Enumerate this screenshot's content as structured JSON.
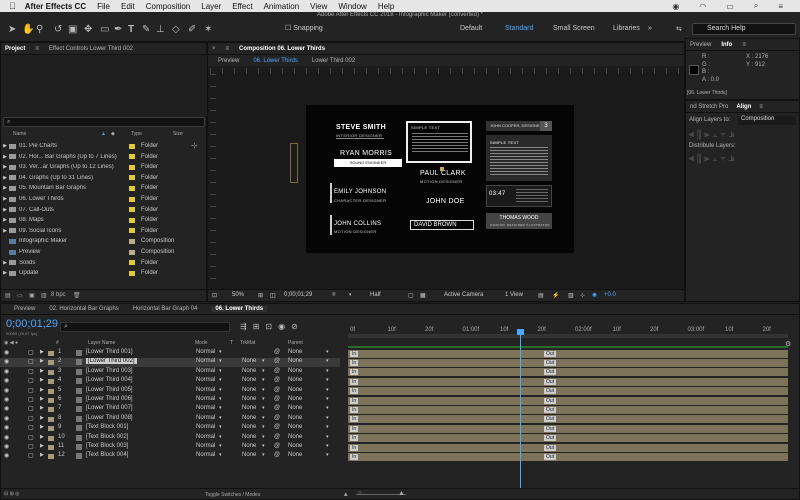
{
  "menubar": {
    "app": "After Effects CC",
    "items": [
      "File",
      "Edit",
      "Composition",
      "Layer",
      "Effect",
      "Animation",
      "View",
      "Window",
      "Help"
    ]
  },
  "toolbar": {
    "doc_title": "Adobe After Effects CC 2018 - Infographic Maker (converted) *",
    "snapping": "Snapping",
    "workspaces": [
      "Default",
      "Standard",
      "Small Screen",
      "Libraries"
    ],
    "search_placeholder": "Search Help"
  },
  "project": {
    "tabs": [
      "Project",
      "Effect Controls Lower Third 002"
    ],
    "search_placeholder": "",
    "columns": {
      "name": "Name",
      "type": "Type",
      "size": "Size"
    },
    "items": [
      {
        "name": "01. Pie Charts",
        "type": "Folder",
        "color": "#e0c93a"
      },
      {
        "name": "02. Hor... Bar Graphs (Up to 7 Lines)",
        "type": "Folder",
        "color": "#e0c93a"
      },
      {
        "name": "03. Ver...ar Graphs (Up to 12 Lines)",
        "type": "Folder",
        "color": "#e0c93a"
      },
      {
        "name": "04. Graphs (Up to 31 Lines)",
        "type": "Folder",
        "color": "#e0c93a"
      },
      {
        "name": "05. Mountain Bar Graphs",
        "type": "Folder",
        "color": "#e0c93a"
      },
      {
        "name": "06. Lower Thirds",
        "type": "Folder",
        "color": "#e0c93a"
      },
      {
        "name": "07. Call-Outs",
        "type": "Folder",
        "color": "#e0c93a"
      },
      {
        "name": "08. Maps",
        "type": "Folder",
        "color": "#e0c93a"
      },
      {
        "name": "09. Social Icons",
        "type": "Folder",
        "color": "#e0c93a"
      },
      {
        "name": "Infographic Maker",
        "type": "Composition",
        "color": "#b8b08c"
      },
      {
        "name": "Preview",
        "type": "Composition",
        "color": "#b8b08c"
      },
      {
        "name": "Solids",
        "type": "Folder",
        "color": "#e0c93a"
      },
      {
        "name": "Update",
        "type": "Folder",
        "color": "#e0c93a"
      }
    ],
    "bpc": "8 bpc"
  },
  "composition": {
    "tab_label": "Composition 06. Lower Thirds",
    "breadcrumbs": [
      "Preview",
      "06. Lower Thirds",
      "Lower Third 002"
    ],
    "zoom": "50%",
    "timecode": "0;00;01;29",
    "resolution": "Half",
    "camera": "Active Camera",
    "views": "1 View",
    "exposure": "+0.0"
  },
  "canvas": {
    "name1": "STEVE SMITH",
    "role1": "INTERIOR DESIGNER",
    "name2": "RYAN MORRIS",
    "role2": "SOUND ENGINEER",
    "name3": "EMILY JOHNSON",
    "role3": "CHARACTER DESIGNER",
    "name4": "JOHN COLLINS",
    "role4": "MOTION DESIGNER",
    "simple_text": "SIMPLE TEXT",
    "name5": "PAUL CLARK",
    "role5": "MOTION DESIGNER",
    "name6": "JOHN DOE",
    "name7": "DAVID BROWN",
    "ribbon1": "JOHN COOPER, DESIGNER",
    "ribbon1_num": "3",
    "box_title": "SIMPLE TEXT",
    "clock": "03:47",
    "name8": "THOMAS WOOD",
    "role8": "GRAPHIC DESIGNER ILLUSTRATOR"
  },
  "right": {
    "preview_tab": "Preview",
    "info_tab": "Info",
    "r": "R :",
    "g": "G :",
    "b": "B :",
    "a": "A : 0.0",
    "x": "X : 2176",
    "y": "Y : 912",
    "lt": "[06. Lower Thirds]",
    "align_tabs": [
      "nd Stretch Pro",
      "Align"
    ],
    "align_to_label": "Align Layers to:",
    "align_to_value": "Composition",
    "distribute_label": "Distribute Layers:"
  },
  "timeline": {
    "tabs": [
      "Preview",
      "02. Horizontal Bar Graphs",
      "Horizontal Bar Graph 04",
      "06. Lower Thirds"
    ],
    "timecode": "0;00;01;29",
    "timecode_sub": "00059 (29.97 fps)",
    "columns": {
      "layer_name": "Layer Name",
      "mode": "Mode",
      "t": "T",
      "trkmat": "TrkMat",
      "parent": "Parent"
    },
    "ruler": [
      "0f",
      "10f",
      "20f",
      "01:00f",
      "10f",
      "20f",
      "02:00f",
      "10f",
      "20f",
      "03:00f",
      "10f",
      "20f"
    ],
    "layers": [
      {
        "num": "1",
        "name": "[Lower Third 001]",
        "mode": "Normal",
        "trkmat": "",
        "parent": "None",
        "in": "In",
        "out": "Out"
      },
      {
        "num": "2",
        "name": "[Lower Third 002]",
        "mode": "Normal",
        "trkmat": "None",
        "parent": "None",
        "in": "In",
        "out": "Out"
      },
      {
        "num": "3",
        "name": "[Lower Third 003]",
        "mode": "Normal",
        "trkmat": "None",
        "parent": "None",
        "in": "In",
        "out": "Out"
      },
      {
        "num": "4",
        "name": "[Lower Third 004]",
        "mode": "Normal",
        "trkmat": "None",
        "parent": "None",
        "in": "In",
        "out": "Out"
      },
      {
        "num": "5",
        "name": "[Lower Third 005]",
        "mode": "Normal",
        "trkmat": "None",
        "parent": "None",
        "in": "In",
        "out": "Out"
      },
      {
        "num": "6",
        "name": "[Lower Third 006]",
        "mode": "Normal",
        "trkmat": "None",
        "parent": "None",
        "in": "In",
        "out": "Out"
      },
      {
        "num": "7",
        "name": "[Lower Third 007]",
        "mode": "Normal",
        "trkmat": "None",
        "parent": "None",
        "in": "In",
        "out": "Out"
      },
      {
        "num": "8",
        "name": "[Lower Third 008]",
        "mode": "Normal",
        "trkmat": "None",
        "parent": "None",
        "in": "In",
        "out": "Out"
      },
      {
        "num": "9",
        "name": "[Text Block 001]",
        "mode": "Normal",
        "trkmat": "None",
        "parent": "None",
        "in": "In",
        "out": "Out"
      },
      {
        "num": "10",
        "name": "[Text Block 002]",
        "mode": "Normal",
        "trkmat": "None",
        "parent": "None",
        "in": "In",
        "out": "Out"
      },
      {
        "num": "11",
        "name": "[Text Block 003]",
        "mode": "Normal",
        "trkmat": "None",
        "parent": "None",
        "in": "In",
        "out": "Out"
      },
      {
        "num": "12",
        "name": "[Text Block 004]",
        "mode": "Normal",
        "trkmat": "None",
        "parent": "None",
        "in": "In",
        "out": "Out"
      }
    ],
    "toggle_label": "Toggle Switches / Modes"
  },
  "colors": {
    "accent": "#4ea7ff",
    "track": "#7d735a",
    "folder": "#e0c93a"
  }
}
